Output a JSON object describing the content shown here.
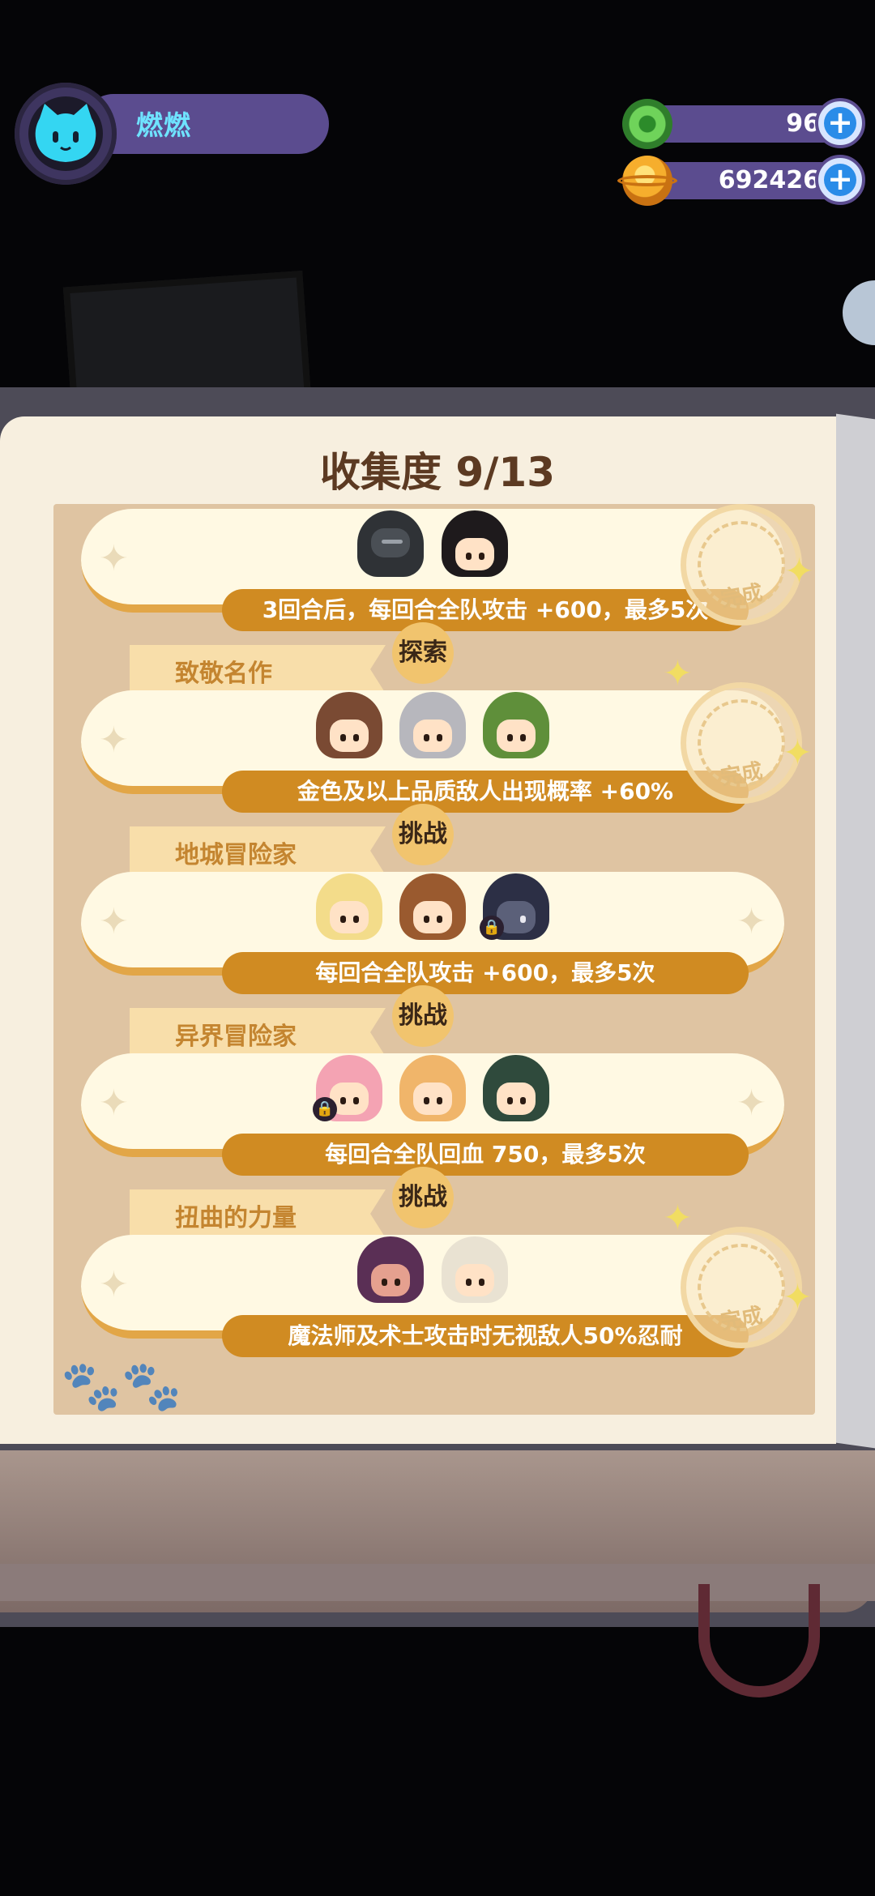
{
  "player": {
    "name": "燃燃"
  },
  "currencies": [
    {
      "name": "green-gem",
      "value": "96",
      "color": "#6fd35a"
    },
    {
      "name": "gold-coin",
      "value": "692426",
      "color": "#f6ae2d"
    }
  ],
  "collection": {
    "title": "收集度 9/13",
    "entries": [
      {
        "ribbon": "",
        "tag": "",
        "bonus": "3回合后，每回合全队攻击 +600，最多5次",
        "completed": true,
        "stamp_text": "完成",
        "characters": [
          "dark-helmet-hero",
          "curly-hair-hero"
        ]
      },
      {
        "ribbon": "致敬名作",
        "tag": "探索",
        "bonus": "金色及以上品质敌人出现概率 +60%",
        "completed": true,
        "stamp_text": "完成",
        "characters": [
          "cowboy-hat-hero",
          "silver-hair-hero",
          "green-cap-hero"
        ]
      },
      {
        "ribbon": "地城冒险家",
        "tag": "挑战",
        "bonus": "每回合全队攻击 +600，最多5次",
        "completed": false,
        "characters": [
          "blonde-hero",
          "bear-hood-hero",
          "dark-wolf-hero-locked"
        ]
      },
      {
        "ribbon": "异界冒险家",
        "tag": "挑战",
        "bonus": "每回合全队回血 750，最多5次",
        "completed": false,
        "characters": [
          "pink-hair-hero-locked",
          "orange-hood-hero",
          "frog-hood-hero"
        ]
      },
      {
        "ribbon": "扭曲的力量",
        "tag": "挑战",
        "bonus": "魔法师及术士攻击时无视敌人50%忍耐",
        "completed": true,
        "stamp_text": "完成",
        "characters": [
          "witch-hat-hero",
          "white-fluffy-hero"
        ]
      }
    ]
  },
  "colors": {
    "accent": "#d08b22",
    "card": "#fff9e3",
    "hud": "#5b4c8f",
    "title": "#5c3a22"
  }
}
